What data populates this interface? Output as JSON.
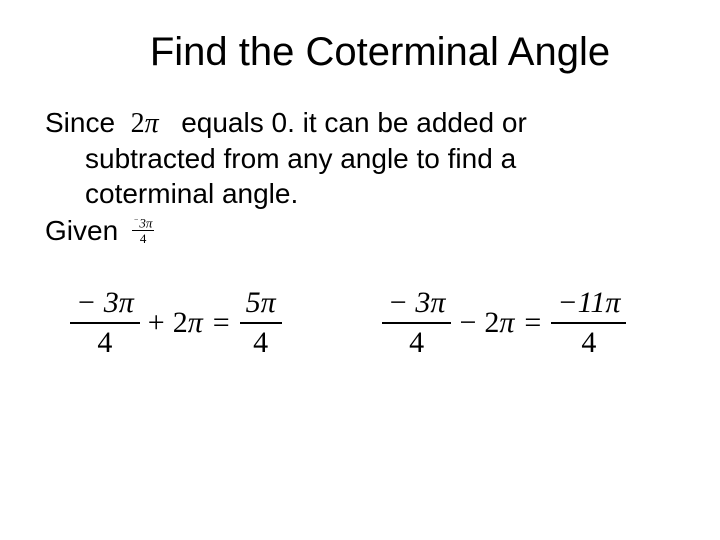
{
  "title": "Find the Coterminal Angle",
  "body": {
    "since_label": "Since",
    "two_pi": "2",
    "pi_sym": "π",
    "equals_phrase": " equals 0. it can be added or",
    "line2": "subtracted from any angle to find a",
    "line3": "coterminal angle.",
    "given_label": "Given",
    "given_frac_num_neg": "−",
    "given_frac_num": "3π",
    "given_frac_den": "4"
  },
  "eq1": {
    "a_num": "− 3π",
    "a_den": "4",
    "op": "+",
    "b": "2",
    "b_pi": "π",
    "eq": "=",
    "r_num": "5π",
    "r_den": "4"
  },
  "eq2": {
    "a_num": "− 3π",
    "a_den": "4",
    "op": "−",
    "b": "2",
    "b_pi": "π",
    "eq": "=",
    "r_num": "−11π",
    "r_den": "4"
  }
}
